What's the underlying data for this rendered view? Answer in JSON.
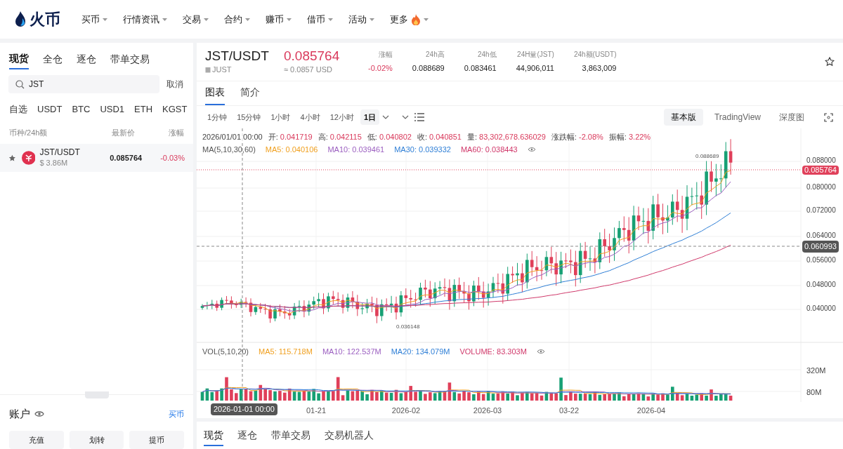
{
  "nav": {
    "logo": "火币",
    "items": [
      {
        "label": "买币",
        "hot": false
      },
      {
        "label": "行情资讯",
        "hot": false
      },
      {
        "label": "交易",
        "hot": false
      },
      {
        "label": "合约",
        "hot": false
      },
      {
        "label": "赚币",
        "hot": false
      },
      {
        "label": "借币",
        "hot": false
      },
      {
        "label": "活动",
        "hot": false
      },
      {
        "label": "更多",
        "hot": true
      }
    ]
  },
  "sidebar": {
    "tabs": [
      {
        "label": "现货",
        "selected": true
      },
      {
        "label": "全仓",
        "selected": false
      },
      {
        "label": "逐仓",
        "selected": false
      },
      {
        "label": "带单交易",
        "selected": false
      }
    ],
    "search": {
      "value": "JST",
      "cancel": "取消"
    },
    "quote_tabs": [
      "自选",
      "USDT",
      "BTC",
      "USD1",
      "ETH",
      "KGST"
    ],
    "columns": [
      "币种/24h额",
      "最新价",
      "涨幅"
    ],
    "rows": [
      {
        "pair": "JST/USDT",
        "volume": "$ 3.86M",
        "price": "0.085764",
        "change": "-0.03%",
        "negative": true
      }
    ],
    "account": {
      "title": "账户",
      "link": "买币",
      "buttons": [
        "充值",
        "划转",
        "提币"
      ]
    }
  },
  "header": {
    "pair": "JST/USDT",
    "name": "JUST",
    "price": "0.085764",
    "usd": "≈ 0.0857 USD",
    "stats": [
      {
        "label": "涨幅",
        "value": "-0.02%",
        "negative": true
      },
      {
        "label": "24h高",
        "value": "0.088689",
        "negative": false
      },
      {
        "label": "24h低",
        "value": "0.083461",
        "negative": false
      },
      {
        "label": "24H量(JST)",
        "value": "44,906,011",
        "negative": false
      },
      {
        "label": "24h额(USDT)",
        "value": "3,863,009",
        "negative": false
      }
    ]
  },
  "chart_tabs": [
    {
      "label": "图表",
      "selected": true
    },
    {
      "label": "简介",
      "selected": false
    }
  ],
  "intervals": [
    {
      "label": "1分钟",
      "selected": false
    },
    {
      "label": "15分钟",
      "selected": false
    },
    {
      "label": "1小时",
      "selected": false
    },
    {
      "label": "4小时",
      "selected": false
    },
    {
      "label": "12小时",
      "selected": false
    },
    {
      "label": "1日",
      "selected": true
    }
  ],
  "views": [
    {
      "label": "基本版",
      "selected": true
    },
    {
      "label": "TradingView",
      "selected": false
    },
    {
      "label": "深度图",
      "selected": false
    }
  ],
  "chart": {
    "date": "2026/01/01 00:00",
    "ohlc": [
      {
        "label": "开:",
        "value": "0.041719"
      },
      {
        "label": "高:",
        "value": "0.042115"
      },
      {
        "label": "低:",
        "value": "0.040802"
      },
      {
        "label": "收:",
        "value": "0.040851"
      },
      {
        "label": "量:",
        "value": "83,302,678.636029"
      },
      {
        "label": "涨跌幅:",
        "value": "-2.08%"
      },
      {
        "label": "振幅:",
        "value": "3.22%"
      }
    ],
    "ma_label": "MA(5,10,30,60)",
    "ma": [
      {
        "label": "MA5: 0.040106",
        "color": "#f0a020"
      },
      {
        "label": "MA10: 0.039461",
        "color": "#9b5fc0"
      },
      {
        "label": "MA30: 0.039332",
        "color": "#2f7fd6"
      },
      {
        "label": "MA60: 0.038443",
        "color": "#d0386a"
      }
    ],
    "price_ticks": [
      "0.088000",
      "0.080000",
      "0.072000",
      "0.064000",
      "0.056000",
      "0.048000",
      "0.040000"
    ],
    "last_price": "0.085764",
    "crosshair_price": "0.060993",
    "high_label": "0.088689",
    "low_label": "0.036148",
    "vol_label": "VOL(5,10,20)",
    "vol_ma": [
      {
        "label": "MA5: 115.718M",
        "color": "#f0a020"
      },
      {
        "label": "MA10: 122.537M",
        "color": "#9b5fc0"
      },
      {
        "label": "MA20: 134.079M",
        "color": "#2f7fd6"
      },
      {
        "label": "VOLUME: 83.303M",
        "color": "#d0386a"
      }
    ],
    "vol_ticks": [
      "320M",
      "80M"
    ],
    "crosshair_date": "2026-01-01 00:00",
    "x_labels": [
      "01-21",
      "2026-02",
      "2026-03",
      "03-22",
      "2026-04"
    ]
  },
  "bottom_tabs": [
    {
      "label": "现货",
      "selected": true
    },
    {
      "label": "逐仓",
      "selected": false
    },
    {
      "label": "带单交易",
      "selected": false
    },
    {
      "label": "交易机器人",
      "selected": false
    }
  ]
}
